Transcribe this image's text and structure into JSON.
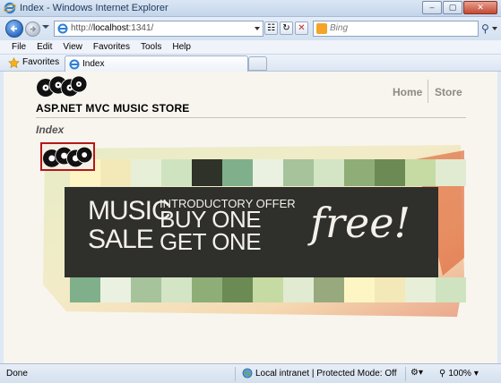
{
  "window": {
    "title": "Index - Windows Internet Explorer"
  },
  "address": {
    "url_prefix": "http://",
    "url_host": "localhost",
    "url_rest": ":1341/"
  },
  "search": {
    "placeholder": "Bing"
  },
  "menu": {
    "items": [
      "File",
      "Edit",
      "View",
      "Favorites",
      "Tools",
      "Help"
    ]
  },
  "favorites": {
    "label": "Favorites"
  },
  "tab": {
    "label": "Index"
  },
  "site": {
    "store_name": "ASP.NET MVC MUSIC STORE",
    "nav": {
      "home": "Home",
      "store": "Store"
    },
    "page_title": "Index"
  },
  "banner": {
    "music": "MUSIC",
    "sale": "SALE",
    "intro": "INTRODUCTORY OFFER",
    "buy": "BUY ONE",
    "get": "GET ONE",
    "free": "free!",
    "stripe_colors": [
      "#fdf6c4",
      "#f3e9b8",
      "#e8efd8",
      "#cfe3c0",
      "#2e3229",
      "#7fb08b",
      "#eaf1e1",
      "#a6c39b",
      "#d3e5c5",
      "#8fae77",
      "#6c8a53",
      "#c6dba3",
      "#e0ebd2",
      "#98a97d"
    ]
  },
  "status": {
    "text": "Done",
    "zone": "Local intranet | Protected Mode: Off",
    "zoom": "100%"
  },
  "colors": {
    "accent": "#b41818",
    "chrome": "#dfe9f5"
  }
}
